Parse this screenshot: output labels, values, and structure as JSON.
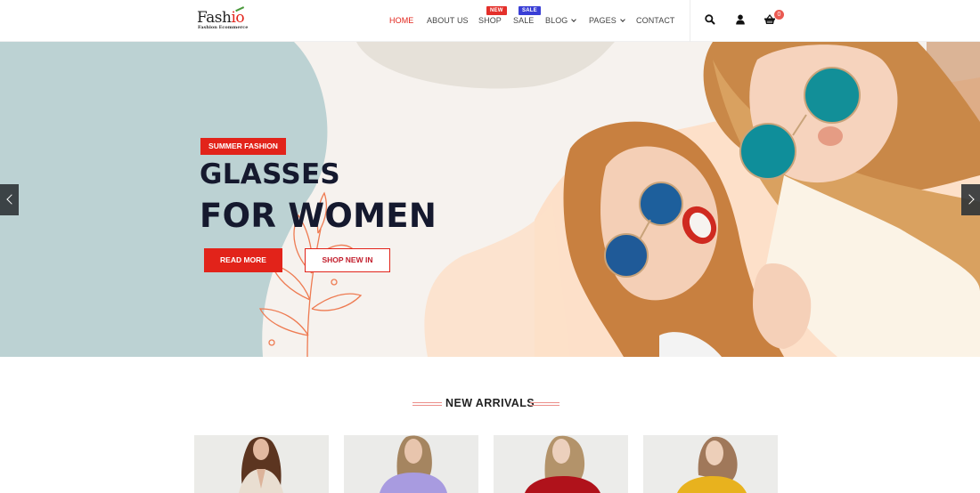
{
  "header": {
    "logo": {
      "brand_dark": "Fash",
      "brand_red": "io",
      "tagline": "Fashion Ecommerce"
    },
    "nav": [
      {
        "label": "HOME",
        "active": true
      },
      {
        "label": "ABOUT US"
      },
      {
        "label": "SHOP",
        "badge": "NEW"
      },
      {
        "label": "SALE",
        "badge": "SALE"
      },
      {
        "label": "BLOG",
        "dropdown": true
      },
      {
        "label": "PAGES",
        "dropdown": true
      },
      {
        "label": "CONTACT"
      }
    ],
    "icons": [
      "search-icon",
      "user-icon",
      "shopping-basket-icon"
    ],
    "cart_count": "0"
  },
  "hero": {
    "tag": "SUMMER FASHION",
    "title_line1": "GLASSES",
    "title_line2": "FOR WOMEN",
    "primary_button": "READ MORE",
    "secondary_button": "SHOP NEW IN",
    "prev_icon": "chevron-left-icon",
    "next_icon": "chevron-right-icon"
  },
  "new_arrivals": {
    "title": "NEW ARRIVALS",
    "products": [
      {
        "image": "model-beige-blouse",
        "color": "#e8dccd"
      },
      {
        "image": "model-lavender-sweater",
        "color": "#a99be0"
      },
      {
        "image": "model-red-sweater",
        "color": "#b3121a"
      },
      {
        "image": "model-yellow-sweater",
        "color": "#e8b21e"
      }
    ]
  },
  "colors": {
    "accent_red": "#e2231a",
    "sale_blue": "#3a3fd6",
    "title_navy": "#15192e"
  }
}
